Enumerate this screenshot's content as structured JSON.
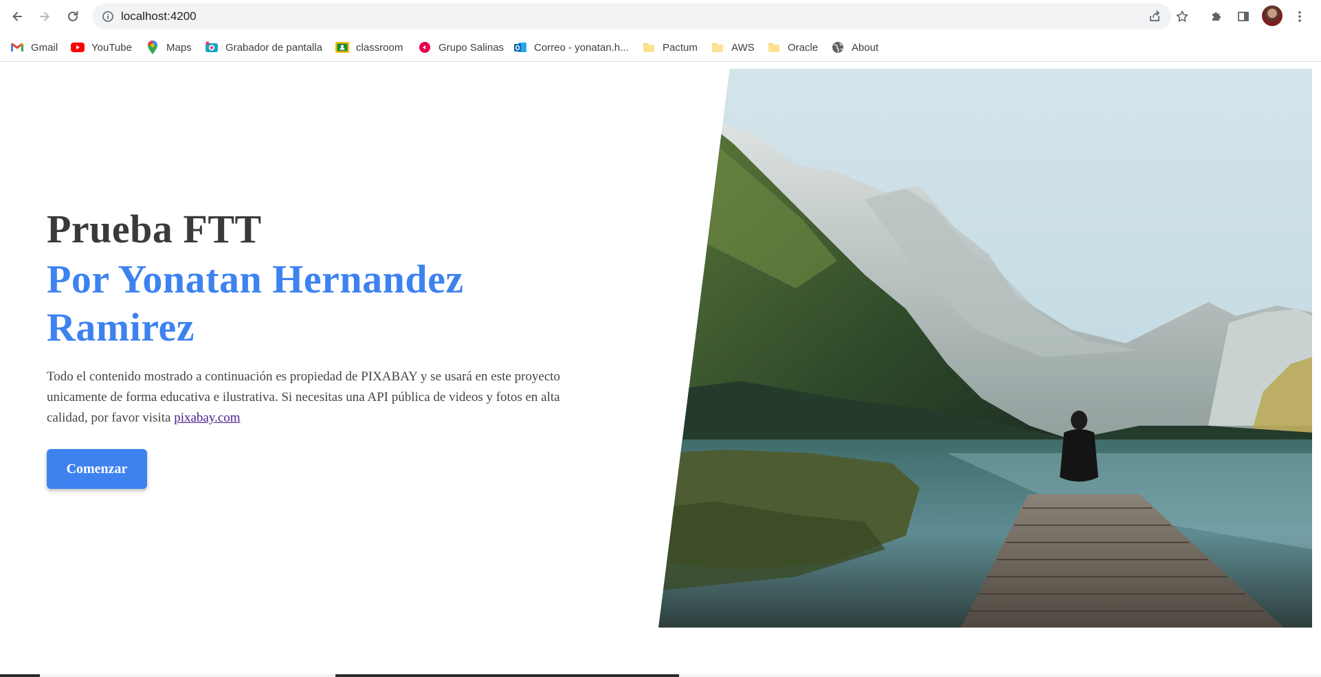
{
  "browser": {
    "url": "localhost:4200",
    "bookmarks": [
      {
        "label": "Gmail",
        "icon": "gmail-icon"
      },
      {
        "label": "YouTube",
        "icon": "youtube-icon"
      },
      {
        "label": "Maps",
        "icon": "maps-icon"
      },
      {
        "label": "Grabador de pantalla",
        "icon": "screen-recorder-icon"
      },
      {
        "label": "classroom",
        "icon": "classroom-icon"
      },
      {
        "label": "Grupo Salinas",
        "icon": "grupo-salinas-icon"
      },
      {
        "label": "Correo - yonatan.h...",
        "icon": "outlook-icon"
      },
      {
        "label": "Pactum",
        "icon": "folder-icon"
      },
      {
        "label": "AWS",
        "icon": "folder-icon"
      },
      {
        "label": "Oracle",
        "icon": "folder-icon"
      },
      {
        "label": "About",
        "icon": "globe-icon"
      }
    ]
  },
  "hero": {
    "title": "Prueba FTT",
    "subtitle": "Por Yonatan Hernandez Ramirez",
    "description": "Todo el contenido mostrado a continuación es propiedad de PIXABAY y se usará en este proyecto unicamente de forma educativa e ilustrativa. Si necesitas una API pública de videos y fotos en alta calidad, por favor visita ",
    "link_text": "pixabay.com",
    "button_label": "Comenzar"
  },
  "colors": {
    "accent": "#3e82f0",
    "title": "#3a3a3a",
    "text": "#444444",
    "link": "#4a1d8c"
  }
}
